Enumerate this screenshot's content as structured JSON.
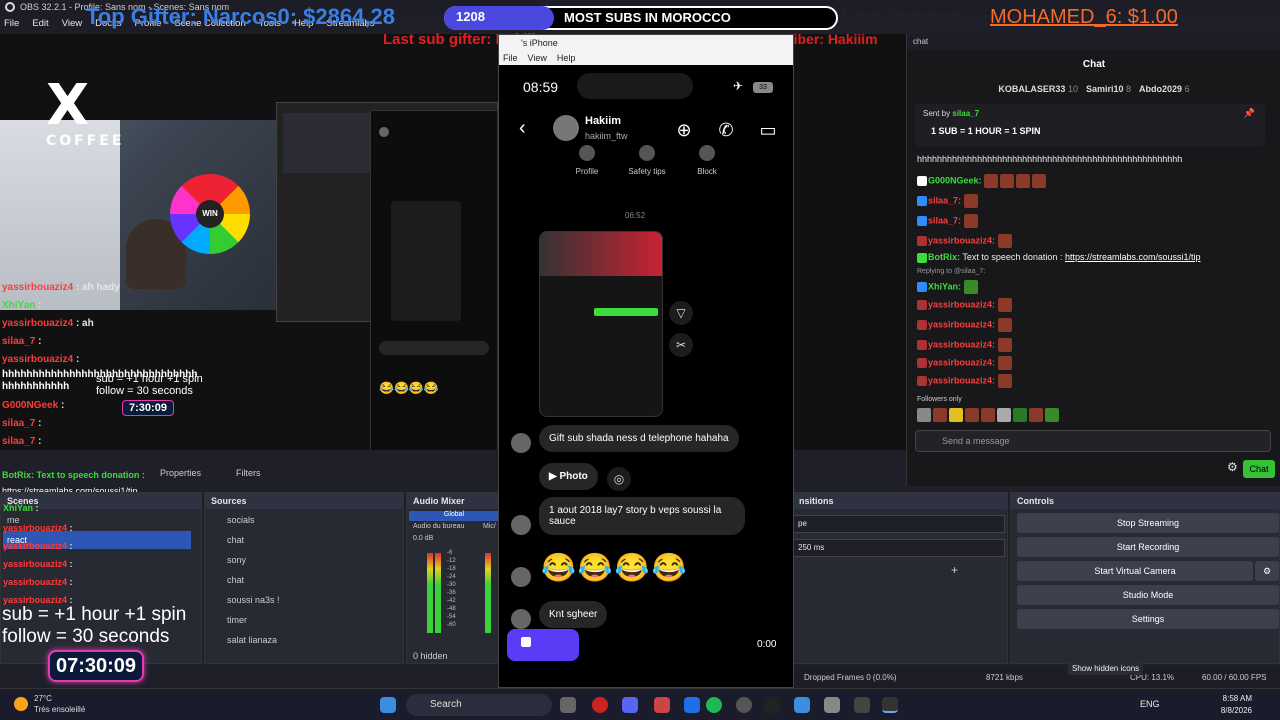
{
  "window": {
    "title": "OBS 32.2.1 - Profile: Sans nom - Scenes: Sans nom"
  },
  "menu": [
    "File",
    "Edit",
    "View",
    "Docks",
    "Profile",
    "Scene Collection",
    "Tools",
    "Help",
    "Streamlabs"
  ],
  "overlay": {
    "top_gifter": "Top Gifter: Narcos0: $2864,28",
    "subs_count": "1208",
    "subs_text": "MOST SUBS IN MOROCCO",
    "last_donator_label": "Last Donator:",
    "last_donator_value": "MOHAMED_6: $1.00",
    "last_gifter": "Last sub gifter: Hakiiim1",
    "last_sub": "Last subscriber: Hakiiim",
    "sub_rule_1": "sub  = +1 hour +1 spin",
    "sub_rule_2": "follow = 30 seconds",
    "timer": "07:30:09",
    "timer_small": "7:30:09",
    "wheel_label": "WIN",
    "logo_sub": "COFFEE",
    "hhh": "hhhhhhhhhhhhhhhhhhhhhhhhhhhhhhhhhhhhhhhhhhh",
    "mini_chat": [
      {
        "user": "yassirbouaziz4",
        "text": ": ah hady",
        "color": "red"
      },
      {
        "user": "XhiYan",
        "text": ":",
        "color": "green"
      },
      {
        "user": "yassirbouaziz4",
        "text": ": ah",
        "color": "red"
      },
      {
        "user": "silaa_7",
        "text": ":",
        "color": "red"
      },
      {
        "user": "yassirbouaziz4",
        "text": ":",
        "color": "red"
      },
      {
        "user": "G000NGeek",
        "text": ":",
        "color": "red"
      },
      {
        "user": "silaa_7",
        "text": ":",
        "color": "red"
      },
      {
        "user": "silaa_7",
        "text": ":",
        "color": "red"
      }
    ],
    "botrix": "BotRix: Text to speech donation :",
    "botrix_url": "https://streamlabs.com/soussi1/tip",
    "lower_chat": [
      {
        "user": "XhiYan",
        "text": ":",
        "color": "green"
      },
      {
        "user": "yassirbouaziz4",
        "text": ":",
        "color": "red"
      },
      {
        "user": "yassirbouaziz4",
        "text": ":",
        "color": "red"
      },
      {
        "user": "yassirbouaziz4",
        "text": ":",
        "color": "red"
      },
      {
        "user": "yassirbouaziz4",
        "text": ":",
        "color": "red"
      },
      {
        "user": "yassirbouaziz4",
        "text": ":",
        "color": "red"
      }
    ]
  },
  "phone": {
    "title": "'s iPhone",
    "menu": [
      "File",
      "View",
      "Help"
    ],
    "time": "08:59",
    "battery": "33",
    "user_name": "Hakiim",
    "user_handle": "hakiim_ftw",
    "quick_actions": [
      "Profile",
      "Safety tips",
      "Block"
    ],
    "stamp": "06:52",
    "messages": {
      "gift": "Gift sub shada ness d telephone hahaha",
      "photo_label": "Photo",
      "story": "1 aout 2018 lay7 story b veps soussi la sauce",
      "emoji": "😂😂😂😂",
      "last": "Knt sgheer"
    },
    "video_time": "0:00"
  },
  "chat": {
    "window_label": "chat",
    "title": "Chat",
    "gifters": [
      {
        "name": "KOBALASER33",
        "count": "10"
      },
      {
        "name": "Samiri10",
        "count": "8"
      },
      {
        "name": "Abdo2029",
        "count": "6"
      }
    ],
    "pinned_by": "Sent by",
    "pinned_user": "silaa_7",
    "pinned_text": "1 SUB = 1 HOUR = 1 SPIN",
    "lines": [
      {
        "user": "",
        "text": "hhhhhhhhhhhhhhhhhhhhhhhhhhhhhhhhhhhhhhhhhhhhhhhhhhhhh"
      },
      {
        "user": "G000NGeek:",
        "text": ""
      },
      {
        "user": "silaa_7:",
        "text": ""
      },
      {
        "user": "silaa_7:",
        "text": ""
      },
      {
        "user": "yassirbouaziz4:",
        "text": ""
      },
      {
        "user": "BotRix:",
        "text": "Text to speech donation :",
        "link": "https://streamlabs.com/soussi1/tip"
      },
      {
        "user": "",
        "text": "Replying to @silaa_7:"
      },
      {
        "user": "XhiYan:",
        "text": ""
      },
      {
        "user": "yassirbouaziz4:",
        "text": ""
      },
      {
        "user": "yassirbouaziz4:",
        "text": ""
      },
      {
        "user": "yassirbouaziz4:",
        "text": ""
      },
      {
        "user": "yassirbouaziz4:",
        "text": ""
      },
      {
        "user": "yassirbouaziz4:",
        "text": ""
      }
    ],
    "followers_only": "Followers only",
    "placeholder": "Send a message",
    "chat_button": "Chat"
  },
  "docks": {
    "scenes_title": "Scenes",
    "scenes": [
      "me",
      "react"
    ],
    "sources_title": "Sources",
    "sources": [
      "socials",
      "chat",
      "sony",
      "chat",
      "soussi na3s !",
      "timer",
      "salat lianaza"
    ],
    "mixer_title": "Audio Mixer",
    "mixer_global": "Global",
    "mixer_device": "Audio du bureau",
    "mixer_device2": "Mic/",
    "mixer_db": "0.0 dB",
    "mixer_ticks": [
      "-6",
      "-12",
      "-18",
      "-24",
      "-30",
      "-36",
      "-42",
      "-48",
      "-54",
      "-60"
    ],
    "mixer_hidden": "0 hidden",
    "transitions_title": "nsitions",
    "transition_value": "pe",
    "duration": "250 ms",
    "controls_title": "Controls",
    "controls": [
      "Stop Streaming",
      "Start Recording",
      "Start Virtual Camera",
      "Studio Mode",
      "Settings"
    ],
    "properties": "Properties",
    "filters": "Filters"
  },
  "status": {
    "hidden_icons": "Show hidden icons",
    "dropped": "Dropped Frames 0 (0.0%)",
    "kbps": "8721 kbps",
    "cpu": "CPU: 13.1%",
    "fps": "60.00 / 60.00 FPS"
  },
  "taskbar": {
    "temp": "27°C",
    "weather": "Très ensoleillé",
    "search": "Search",
    "lang": "ENG",
    "time": "8:58 AM",
    "date": "8/8/2026"
  }
}
